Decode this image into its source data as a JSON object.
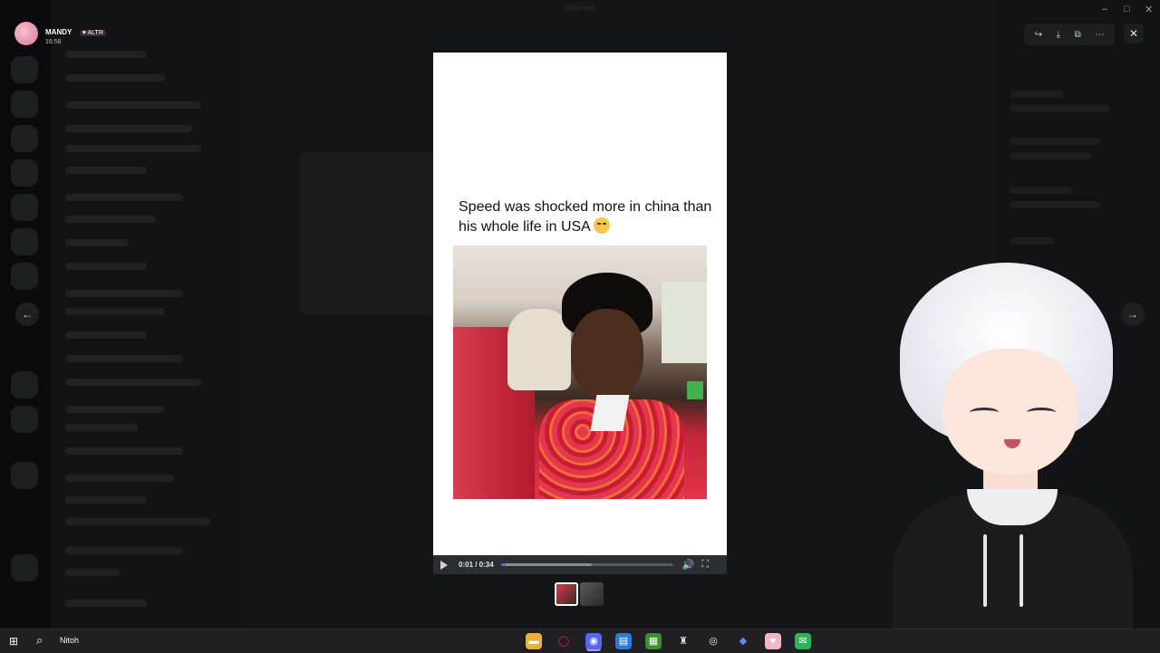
{
  "window": {
    "title": "Discord"
  },
  "user": {
    "name": "MANDY",
    "tag": "ALTR",
    "time": "16:58"
  },
  "viewer": {
    "caption": "Speed was shocked more in china than his whole life in USA",
    "emoji": "crying-laughing-emoji",
    "video": {
      "time": "0:01 / 0:34",
      "progress": 0.03,
      "buffered": 0.53
    },
    "attachments_count": 2,
    "active_attachment": 1
  },
  "toolbar": {
    "icons": [
      "forward-icon",
      "download-icon",
      "open-external-icon",
      "more-icon"
    ],
    "close": "close-icon"
  },
  "taskbar": {
    "search_text": "Nitoh",
    "apps": [
      "file-explorer-icon",
      "opera-icon",
      "discord-icon",
      "spreadsheet-icon",
      "minecraft-icon",
      "app-icon",
      "obs-icon",
      "dev-icon",
      "heart-app-icon",
      "mail-icon"
    ]
  },
  "colors": {
    "accent": "#5865f2",
    "viewer_bg": "#ffffff",
    "overlay": "#0c0c0e"
  }
}
